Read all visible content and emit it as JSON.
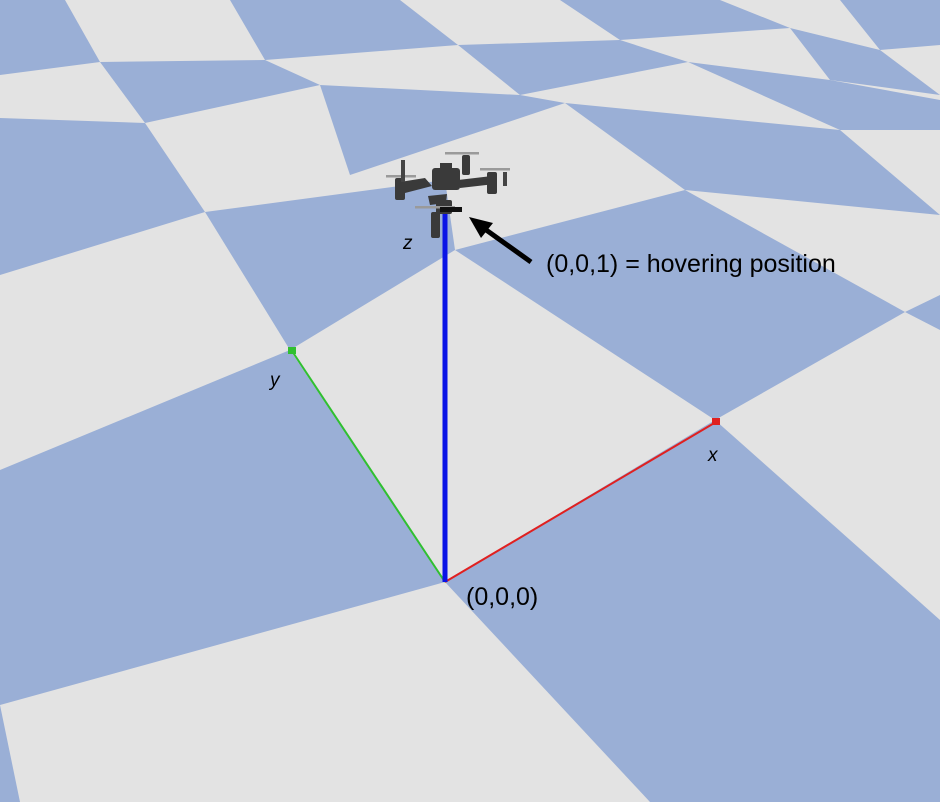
{
  "labels": {
    "z_axis": "z",
    "y_axis": "y",
    "x_axis": "x",
    "origin": "(0,0,0)",
    "hover": "(0,0,1) = hovering position"
  },
  "colors": {
    "floor_blue": "#9aafd6",
    "floor_light": "#e3e3e3",
    "x_axis": "#e02020",
    "y_axis": "#30c030",
    "z_axis": "#0a14e6",
    "annotation": "#000000",
    "drone_body": "#3a3a3a"
  },
  "icons": {
    "drone": "quadcopter-drone",
    "arrow": "annotation-arrow"
  }
}
